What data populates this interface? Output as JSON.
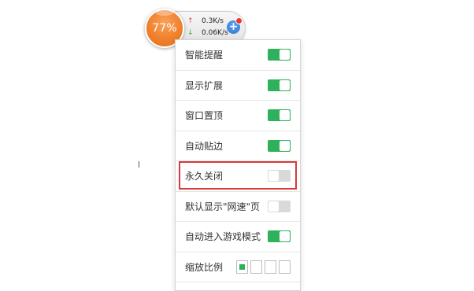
{
  "speed_ball": {
    "percent": "77%",
    "upload_speed": "0.3K/s",
    "download_speed": "0.06K/s",
    "upload_arrow": "↑",
    "download_arrow": "↓",
    "plus": "+"
  },
  "menu": {
    "items": [
      {
        "label": "智能提醒",
        "state": "on"
      },
      {
        "label": "显示扩展",
        "state": "on"
      },
      {
        "label": "窗口置顶",
        "state": "on"
      },
      {
        "label": "自动贴边",
        "state": "on"
      },
      {
        "label": "永久关闭",
        "state": "off"
      },
      {
        "label": "默认显示\"网速\"页",
        "state": "off"
      },
      {
        "label": "自动进入游戏模式",
        "state": "on"
      }
    ],
    "zoom": {
      "label": "缩放比例",
      "options_count": 4,
      "selected_index": 0
    }
  },
  "colors": {
    "toggle_on": "#2fb05a",
    "toggle_off": "#d9d9d9",
    "highlight": "#d63a3a",
    "ball_orange": "#f0812c"
  }
}
